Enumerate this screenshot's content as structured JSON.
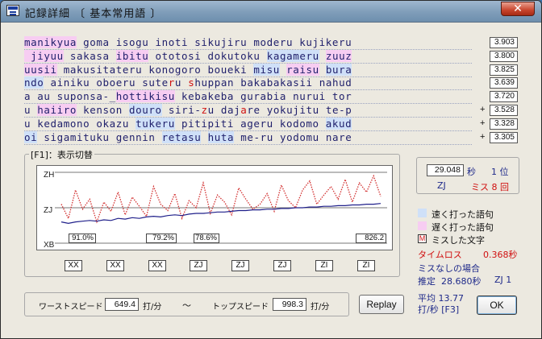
{
  "window": {
    "title": "記録詳細 〔 基本常用語 〕",
    "close_label": "✕"
  },
  "text_lines": [
    {
      "segments": [
        {
          "text": "manikyua",
          "style": "slow"
        },
        {
          "text": " goma isogu inoti sikujiru moderu kujikeru",
          "style": ""
        }
      ],
      "speed": "3.903",
      "plus": ""
    },
    {
      "segments": [
        {
          "text": " jiyuu",
          "style": "slow"
        },
        {
          "text": " sakasa ",
          "style": ""
        },
        {
          "text": "ibitu",
          "style": "slow"
        },
        {
          "text": " ototosi dokutoku ",
          "style": ""
        },
        {
          "text": "kagameru",
          "style": "fast"
        },
        {
          "text": " ",
          "style": ""
        },
        {
          "text": "zuuz",
          "style": "slow"
        }
      ],
      "speed": "3.800",
      "plus": ""
    },
    {
      "segments": [
        {
          "text": "uusii",
          "style": "slow"
        },
        {
          "text": " makusitateru konogoro boueki ",
          "style": ""
        },
        {
          "text": "misu",
          "style": "fast"
        },
        {
          "text": " ",
          "style": ""
        },
        {
          "text": "raisu",
          "style": "slow"
        },
        {
          "text": " ",
          "style": ""
        },
        {
          "text": "bura",
          "style": "fast"
        }
      ],
      "speed": "3.825",
      "plus": ""
    },
    {
      "segments": [
        {
          "text": "ndo",
          "style": "fast"
        },
        {
          "text": " ainiku oboeru sute",
          "style": ""
        },
        {
          "text": "r",
          "style": "miss"
        },
        {
          "text": "u ",
          "style": ""
        },
        {
          "text": "s",
          "style": "miss"
        },
        {
          "text": "huppan bakabakasii nahud",
          "style": ""
        }
      ],
      "speed": "3.639",
      "plus": ""
    },
    {
      "segments": [
        {
          "text": "a au suponsa-_",
          "style": ""
        },
        {
          "text": "hottikisu",
          "style": "slow"
        },
        {
          "text": " kebakeba gurabia nurui tor",
          "style": ""
        }
      ],
      "speed": "3.720",
      "plus": ""
    },
    {
      "segments": [
        {
          "text": "u ",
          "style": ""
        },
        {
          "text": "haiiro",
          "style": "slow"
        },
        {
          "text": " kenson ",
          "style": ""
        },
        {
          "text": "douro",
          "style": "fast"
        },
        {
          "text": " siri-",
          "style": ""
        },
        {
          "text": "z",
          "style": "miss"
        },
        {
          "text": "u daj",
          "style": ""
        },
        {
          "text": "a",
          "style": "miss"
        },
        {
          "text": "re yokujitu te-p",
          "style": ""
        }
      ],
      "speed": "3.528",
      "plus": "+"
    },
    {
      "segments": [
        {
          "text": "u kedamono okazu ",
          "style": ""
        },
        {
          "text": "tukeru",
          "style": "fast"
        },
        {
          "text": " pitipiti ageru kodomo ",
          "style": ""
        },
        {
          "text": "akud",
          "style": "fast"
        }
      ],
      "speed": "3.328",
      "plus": "+"
    },
    {
      "segments": [
        {
          "text": "oi",
          "style": "fast"
        },
        {
          "text": " sigamituku gennin ",
          "style": ""
        },
        {
          "text": "retasu",
          "style": "fast"
        },
        {
          "text": " ",
          "style": ""
        },
        {
          "text": "huta",
          "style": "fast"
        },
        {
          "text": " me-ru yodomu nare",
          "style": ""
        }
      ],
      "speed": "3.305",
      "plus": "+"
    }
  ],
  "chart_section": {
    "label": "[F1]：表示切替",
    "y_labels": [
      "ZH",
      "ZJ",
      "XB"
    ],
    "rates": [
      "91.0%",
      "79.2%",
      "78.6%",
      "826.2"
    ],
    "ranks": [
      "XX",
      "XX",
      "XX",
      "ZJ",
      "ZJ",
      "ZJ",
      "ZI",
      "ZI"
    ]
  },
  "chart_data": {
    "type": "line",
    "series": [
      {
        "name": "",
        "color": "#d23030",
        "style": "dotted",
        "values": [
          0.55,
          0.35,
          0.75,
          0.48,
          0.62,
          0.3,
          0.58,
          0.45,
          0.72,
          0.4,
          0.65,
          0.52,
          0.38,
          0.8,
          0.55,
          0.46,
          0.7,
          0.35,
          0.6,
          0.5,
          0.85,
          0.42,
          0.68,
          0.58,
          0.4,
          0.78,
          0.62,
          0.48,
          0.55,
          0.7,
          0.45,
          0.82,
          0.6,
          0.5,
          0.75,
          0.88,
          0.55,
          0.68,
          0.8,
          0.62,
          0.9,
          0.58,
          0.85,
          0.72,
          0.95,
          0.66
        ]
      },
      {
        "name": "",
        "color": "#1f1f8a",
        "style": "solid",
        "values": [
          0.3,
          0.28,
          0.3,
          0.31,
          0.32,
          0.31,
          0.33,
          0.32,
          0.35,
          0.34,
          0.36,
          0.35,
          0.37,
          0.38,
          0.37,
          0.39,
          0.4,
          0.39,
          0.41,
          0.42,
          0.42,
          0.43,
          0.44,
          0.44,
          0.45,
          0.46,
          0.46,
          0.47,
          0.47,
          0.48,
          0.48,
          0.49,
          0.49,
          0.5,
          0.5,
          0.51,
          0.51,
          0.52,
          0.52,
          0.53,
          0.53,
          0.54,
          0.54,
          0.55,
          0.55,
          0.56
        ]
      }
    ]
  },
  "score": {
    "time": "29.048",
    "time_unit": "秒",
    "rank_pos": "1 位",
    "rank": "ZJ",
    "miss": "ミス 8 回"
  },
  "legend": {
    "fast_label": "速く打った語句",
    "fast_color": "#cfe0f8",
    "slow_label": "遅く打った語句",
    "slow_color": "#f7cdf2",
    "miss_marker": "M",
    "miss_label": "ミスした文字"
  },
  "timeloss": {
    "label": "タイムロス",
    "value": "0.368秒"
  },
  "nomiss": {
    "heading": "ミスなしの場合",
    "estimate_label": "推定",
    "estimate_value": "28.680秒",
    "estimate_rank": "ZJ  1"
  },
  "average": {
    "line1": "平均 13.77",
    "line2": "打/秒 [F3]"
  },
  "speeds": {
    "worst_label": "ワーストスピード 1",
    "worst_value": "649.4",
    "worst_unit": "打/分",
    "tilde": "〜",
    "top_label": "トップスピード",
    "top_value": "998.3",
    "top_unit": "打/分"
  },
  "buttons": {
    "replay": "Replay",
    "ok": "OK"
  }
}
